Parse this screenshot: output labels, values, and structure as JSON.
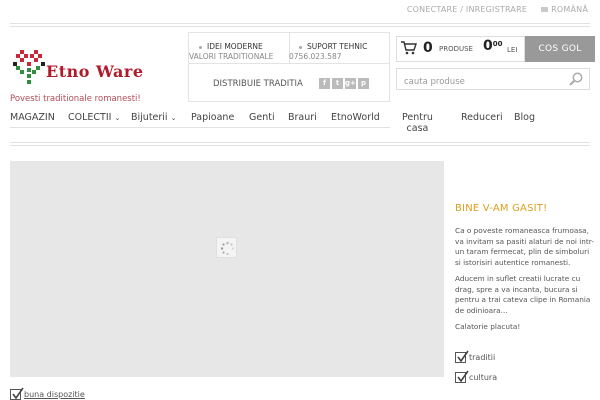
{
  "topbar": {
    "account_link": "CONECTARE / INREGISTRARE",
    "language": "ROMÂNĂ"
  },
  "brand": {
    "logo_text": "Etno Ware",
    "tagline": "Povesti traditionale romanesti!"
  },
  "header": {
    "ideas_title": "IDEI MODERNE",
    "ideas_sub": "VALORI TRADITIONALE",
    "support_title": "SUPORT TEHNIC",
    "support_phone": "0756.023.587",
    "distrib_label": "DISTRIBUIE TRADITIA",
    "social": [
      {
        "icon": "facebook-icon",
        "glyph": "f"
      },
      {
        "icon": "twitter-icon",
        "glyph": "t"
      },
      {
        "icon": "google-plus-icon",
        "glyph": "g+"
      },
      {
        "icon": "pinterest-icon",
        "glyph": "p"
      }
    ]
  },
  "cart": {
    "count": "0",
    "count_label": "PRODUSE",
    "price_main": "0",
    "price_cents": "00",
    "currency": "LEI",
    "button_label": "COS GOL"
  },
  "search": {
    "placeholder": "cauta produse"
  },
  "nav": {
    "items": [
      {
        "label": "MAGAZIN"
      },
      {
        "label": "COLECTII"
      },
      {
        "label": "Bijuterii"
      },
      {
        "label": "Papioane"
      },
      {
        "label": "Genti"
      },
      {
        "label": "Brauri"
      },
      {
        "label": "EtnoWorld"
      },
      {
        "label": "Pentru"
      },
      {
        "label": "casa"
      },
      {
        "label": "Reduceri"
      },
      {
        "label": "Blog"
      }
    ]
  },
  "welcome": {
    "title": "BINE V-AM GASIT!",
    "para1": "Ca o poveste romaneasca frumoasa, va invitam sa pasiti alaturi de noi intr-un taram fermecat, plin de simboluri si istorisiri autentice romanesti.",
    "para2": "Aducem in suflet creatii lucrate cu drag, spre a va incanta, bucura si pentru a trai cateva clipe in Romania de odinioara...",
    "para3": "Calatorie placuta!",
    "checks": [
      {
        "label": "traditii"
      },
      {
        "label": "cultura"
      },
      {
        "label": "buna dispozitie"
      }
    ]
  },
  "colors": {
    "accent_gold": "#d9a21f",
    "brand_red": "#b01a2a",
    "button_gray": "#999999"
  }
}
